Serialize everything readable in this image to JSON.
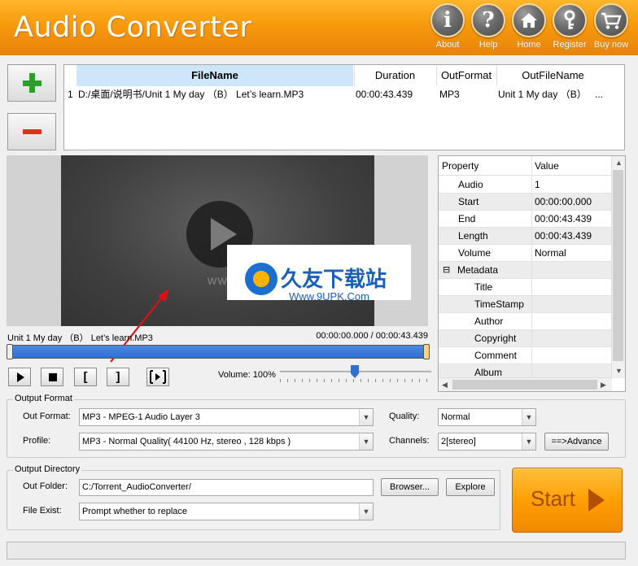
{
  "app": {
    "title": "Audio Converter"
  },
  "header_buttons": [
    {
      "label": "About",
      "icon": "info-icon"
    },
    {
      "label": "Help",
      "icon": "help-icon"
    },
    {
      "label": "Home",
      "icon": "home-icon"
    },
    {
      "label": "Register",
      "icon": "key-icon"
    },
    {
      "label": "Buy now",
      "icon": "cart-icon"
    }
  ],
  "file_table": {
    "columns": [
      "FileName",
      "Duration",
      "OutFormat",
      "OutFileName"
    ],
    "rows": [
      {
        "index": "1",
        "filename": "D:/桌面/说明书/Unit 1 My day （B） Let’s learn.MP3",
        "duration": "00:00:43.439",
        "outformat": "MP3",
        "outfilename": "Unit 1 My day （B）",
        "more": "..."
      }
    ]
  },
  "player": {
    "track_name": "Unit 1 My day （B） Let’s learn.MP3",
    "time": "00:00:00.000 / 00:00:43.439",
    "volume_label": "Volume: 100%",
    "volume_level": 1.0,
    "buttons": {
      "open": "[",
      "close": "]"
    }
  },
  "watermark": {
    "url_text": "WWW.9UPK.COM",
    "cn": "久友下载站",
    "sub": "Www.9UPK.Com"
  },
  "properties": {
    "header": {
      "key": "Property",
      "value": "Value"
    },
    "rows": [
      {
        "key": "Audio",
        "value": "1",
        "indent": 1
      },
      {
        "key": "Start",
        "value": "00:00:00.000",
        "indent": 1
      },
      {
        "key": "End",
        "value": "00:00:43.439",
        "indent": 1
      },
      {
        "key": "Length",
        "value": "00:00:43.439",
        "indent": 1
      },
      {
        "key": "Volume",
        "value": "Normal",
        "indent": 1
      },
      {
        "key": "Metadata",
        "value": "",
        "indent": 0,
        "expander": "⊟"
      },
      {
        "key": "Title",
        "value": "",
        "indent": 2
      },
      {
        "key": "TimeStamp",
        "value": "",
        "indent": 2
      },
      {
        "key": "Author",
        "value": "",
        "indent": 2
      },
      {
        "key": "Copyright",
        "value": "",
        "indent": 2
      },
      {
        "key": "Comment",
        "value": "",
        "indent": 2
      },
      {
        "key": "Album",
        "value": "",
        "indent": 2
      }
    ]
  },
  "output_format": {
    "group_title": "Output Format",
    "out_format_label": "Out Format:",
    "out_format_value": "MP3 - MPEG-1 Audio Layer 3",
    "profile_label": "Profile:",
    "profile_value": "MP3 - Normal Quality( 44100 Hz, stereo , 128 kbps )",
    "quality_label": "Quality:",
    "quality_value": "Normal",
    "channels_label": "Channels:",
    "channels_value": "2[stereo]",
    "advance_label": "==>Advance"
  },
  "output_directory": {
    "group_title": "Output Directory",
    "folder_label": "Out Folder:",
    "folder_value": "C:/Torrent_AudioConverter/",
    "browser_label": "Browser...",
    "explore_label": "Explore",
    "file_exist_label": "File Exist:",
    "file_exist_value": "Prompt whether to replace"
  },
  "start_label": "Start",
  "colors": {
    "header": "#f79a0c",
    "progress": "#2f6fd1",
    "start": "#ff9c00",
    "accent_green": "#2e9d2a",
    "accent_red": "#d7351b"
  }
}
